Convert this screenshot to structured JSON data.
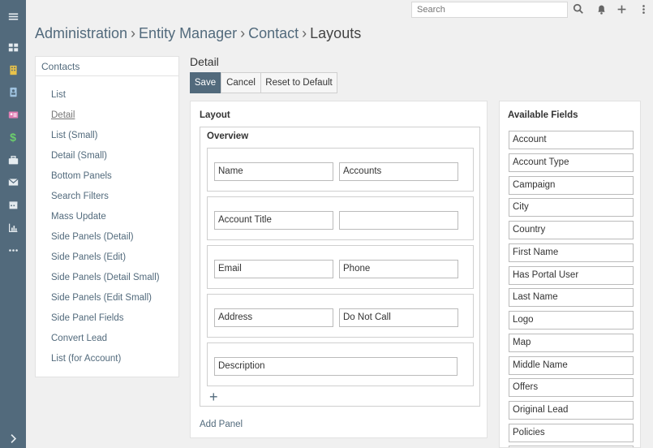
{
  "search": {
    "placeholder": "Search"
  },
  "breadcrumb": {
    "items": [
      "Administration",
      "Entity Manager",
      "Contact"
    ],
    "current": "Layouts"
  },
  "left_panel": {
    "header": "Contacts",
    "items": [
      "List",
      "Detail",
      "List (Small)",
      "Detail (Small)",
      "Bottom Panels",
      "Search Filters",
      "Mass Update",
      "Side Panels (Detail)",
      "Side Panels (Edit)",
      "Side Panels (Detail Small)",
      "Side Panels (Edit Small)",
      "Side Panel Fields",
      "Convert Lead",
      "List (for Account)"
    ],
    "active": "Detail"
  },
  "title": "Detail",
  "buttons": {
    "save": "Save",
    "cancel": "Cancel",
    "reset": "Reset to Default"
  },
  "layout": {
    "label": "Layout",
    "panel_title": "Overview",
    "rows": [
      [
        "Name",
        "Accounts"
      ],
      [
        "Account Title",
        ""
      ],
      [
        "Email",
        "Phone"
      ],
      [
        "Address",
        "Do Not Call"
      ],
      [
        "Description"
      ]
    ],
    "add_row": "+",
    "add_panel": "Add Panel"
  },
  "available_fields": {
    "label": "Available Fields",
    "fields": [
      "Account",
      "Account Type",
      "Campaign",
      "City",
      "Country",
      "First Name",
      "Has Portal User",
      "Last Name",
      "Logo",
      "Map",
      "Middle Name",
      "Offers",
      "Original Lead",
      "Policies",
      ""
    ]
  },
  "icons": {
    "rail": [
      "menu-icon",
      "dashboard-icon",
      "building-icon",
      "contact-book-icon",
      "id-card-icon",
      "dollar-icon",
      "briefcase-icon",
      "envelope-icon",
      "calendar-icon",
      "bar-chart-icon",
      "more-icon",
      "chevron-right-icon"
    ],
    "top": [
      "search-icon",
      "bell-icon",
      "plus-icon",
      "kebab-icon"
    ]
  },
  "colors": {
    "accent": "#526a7c",
    "rail": "#526a7c",
    "text": "#333333"
  }
}
